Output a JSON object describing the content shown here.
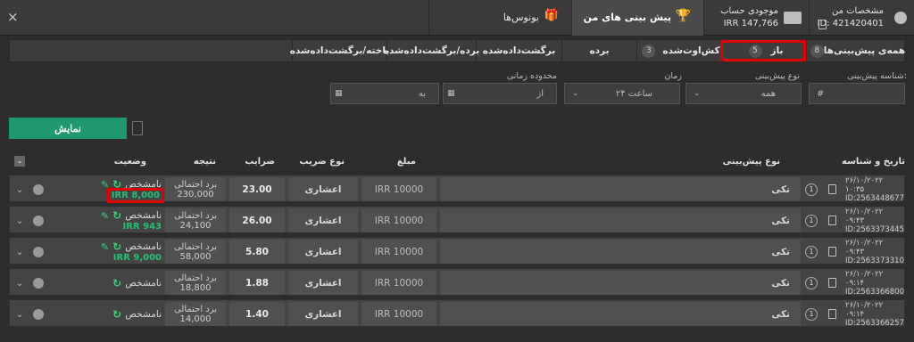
{
  "top_tabs": {
    "profile": {
      "line1": "مشخصات من",
      "line2": "ID: 421420401"
    },
    "balance": {
      "line1": "موجودی حساب",
      "line2": "IRR 147,766"
    },
    "my_bets": {
      "label": "پیش بینی های من"
    },
    "bonus": {
      "label": "بونوس‌ها"
    },
    "close": "×"
  },
  "filter_tabs": [
    {
      "label": "همه‌ی پیش‌بینی‌ها",
      "count": "8"
    },
    {
      "label": "باز",
      "count": "5",
      "active": true
    },
    {
      "label": "کش‌اوت‌شده",
      "count": "3"
    },
    {
      "label": "برده",
      "count": ""
    },
    {
      "label": "برگشت‌داده‌شده",
      "count": ""
    },
    {
      "label": "برده/برگشت‌داده‌شده",
      "count": ""
    },
    {
      "label": "باخته/برگشت‌داده‌شده",
      "count": ""
    }
  ],
  "form": {
    "bet_id_label": "شناسه پیش‌بینی:",
    "bet_id_placeholder": "#",
    "bet_type_label": "نوع پیش‌بینی",
    "bet_type_value": "همه",
    "time_label": "زمان",
    "time_value": "۲۴ ساعت",
    "range_label": "محدوده زمانی",
    "from_placeholder": "از",
    "to_placeholder": "به",
    "show_button": "نمایش"
  },
  "table": {
    "headers": {
      "date_id": "تاریخ و شناسه",
      "bet_type": "نوع پیش‌بینی",
      "amount": "مبلغ",
      "odds_type": "نوع ضریب",
      "odds": "ضرایب",
      "result": "نتیجه",
      "status": "وضعیت"
    },
    "rows": [
      {
        "date": "۲۶/۱۰/۲۰۲۲ ۱۰:۳۵",
        "id": "ID:2563448677",
        "stage": "1",
        "type": "تکی",
        "amount": "IRR 10000",
        "odds_type": "اعشاری",
        "odds": "23.00",
        "result_label": "برد احتمالی",
        "result_value": "230,000",
        "status": "نامشخص",
        "cashout": "IRR 8,000",
        "cashout_highlight": true
      },
      {
        "date": "۲۶/۱۰/۲۰۲۲ ۰۹:۴۳",
        "id": "ID:2563373445",
        "stage": "1",
        "type": "تکی",
        "amount": "IRR 10000",
        "odds_type": "اعشاری",
        "odds": "26.00",
        "result_label": "برد احتمالی",
        "result_value": "24,100",
        "status": "نامشخص",
        "cashout": "IRR 943"
      },
      {
        "date": "۲۶/۱۰/۲۰۲۲ ۰۹:۴۳",
        "id": "ID:2563373310",
        "stage": "1",
        "type": "تکی",
        "amount": "IRR 10000",
        "odds_type": "اعشاری",
        "odds": "5.80",
        "result_label": "برد احتمالی",
        "result_value": "58,000",
        "status": "نامشخص",
        "cashout": "IRR 9,000"
      },
      {
        "date": "۲۶/۱۰/۲۰۲۲ ۰۹:۱۴",
        "id": "ID:2563366800",
        "stage": "1",
        "type": "تکی",
        "amount": "IRR 10000",
        "odds_type": "اعشاری",
        "odds": "1.88",
        "result_label": "برد احتمالی",
        "result_value": "18,800",
        "status": "نامشخص",
        "cashout": ""
      },
      {
        "date": "۲۶/۱۰/۲۰۲۲ ۰۹:۱۴",
        "id": "ID:2563366257",
        "stage": "1",
        "type": "تکی",
        "amount": "IRR 10000",
        "odds_type": "اعشاری",
        "odds": "1.40",
        "result_label": "برد احتمالی",
        "result_value": "14,000",
        "status": "نامشخص",
        "cashout": ""
      }
    ]
  },
  "colors": {
    "accent": "#1f9a6e",
    "cashout": "#25c173",
    "highlight": "#e00000"
  }
}
